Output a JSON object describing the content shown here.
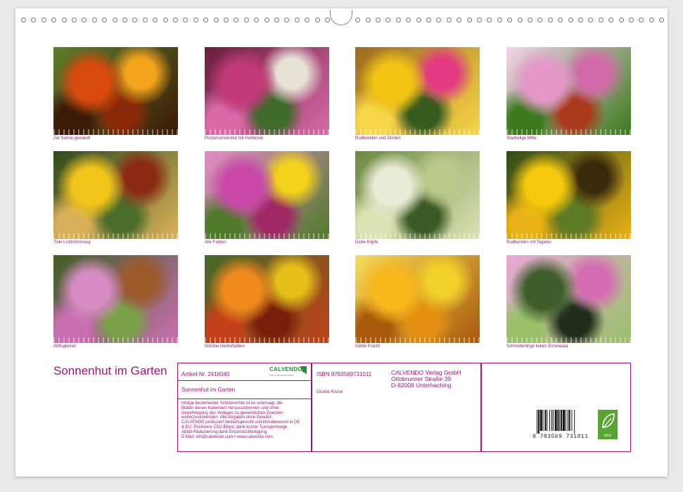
{
  "calendar": {
    "title": "Sonnenhut im Garten",
    "photos": [
      {
        "caption": "Zur Sonne gewandt"
      },
      {
        "caption": "Purpursonnenhut mit Hortensie"
      },
      {
        "caption": "Rudbecklen und Zinnien"
      },
      {
        "caption": "Stachelige Mitte"
      },
      {
        "caption": "Tolle Lichtstimmung"
      },
      {
        "caption": "Alle Farben"
      },
      {
        "caption": "Dicke Köpfe"
      },
      {
        "caption": "Rudbeckien mit Tagetes"
      },
      {
        "caption": "Abflugbereit"
      },
      {
        "caption": "Schöne Herbstfarben"
      },
      {
        "caption": "Gelbe Pracht"
      },
      {
        "caption": "Schmetterlinge lieben Echinacea"
      }
    ]
  },
  "info": {
    "article_no": "Artikel-Nr. 2416040",
    "calvendo_logo": "CALVENDO",
    "calvendo_sub": "Die Kalendermarke",
    "product_title": "Sonnenhut im Garten",
    "legal_lines": [
      "Infolge bestehender Schutzrechte ist es untersagt, die",
      "Blätter dieses Kalenders herauszutrennen und ohne",
      "Genehmigung des Verlages zu gewerblichen Zwecken",
      "weiterzuverwenden. Alle Angaben ohne Gewähr.",
      "CALVENDO produziert bedarfsgerecht und klimabewusst in DE",
      "& EU. Positivere CO2-Bilanz dank kurzer Transportwege.",
      "Abfall-Reduzierung dank Einzelstückfertigung.",
      "E-Mail: info@calvendo.com • www.calvendo.com"
    ],
    "isbn": "ISBN 9783569731011",
    "author": "Gisela Kruse",
    "publisher_lines": [
      "CALVENDO Verlag GmbH",
      "Ottobrunner Straße 39",
      "D-82008 Unterhaching"
    ],
    "barcode_number": "9   783569   731011",
    "eco_label": "eco"
  },
  "colors": {
    "accent": "#a0157a",
    "eco_green": "#59a532"
  }
}
